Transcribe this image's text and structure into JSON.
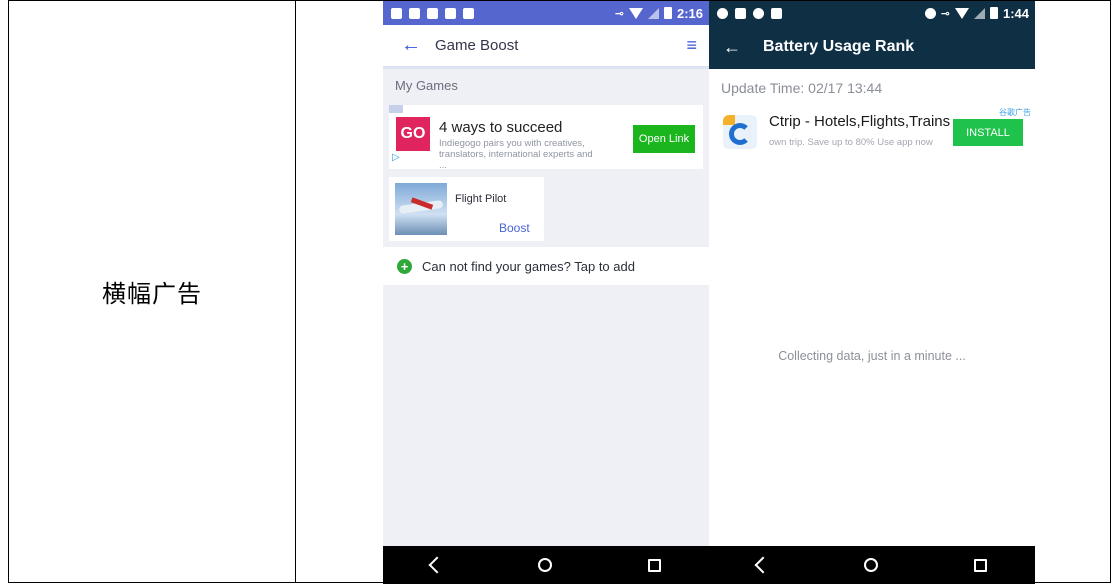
{
  "doc": {
    "label": "横幅广告"
  },
  "screen1": {
    "status": {
      "time": "2:16"
    },
    "toolbar": {
      "title": "Game Boost",
      "back_icon": "←",
      "sort_icon": "≡"
    },
    "section_title": "My Games",
    "ad": {
      "logo": "GO",
      "headline": "4 ways to succeed",
      "body": "Indiegogo pairs you with creatives, translators, international experts and ...",
      "button": "Open Link"
    },
    "game": {
      "name": "Flight Pilot",
      "action": "Boost"
    },
    "add_row": {
      "text": "Can not find your games? Tap to add",
      "icon": "+"
    }
  },
  "screen2": {
    "status": {
      "time": "1:44"
    },
    "toolbar": {
      "title": "Battery Usage Rank",
      "back_icon": "←"
    },
    "update_time": "Update Time: 02/17 13:44",
    "ad": {
      "tag": "谷歌广告",
      "app_name": "Ctrip - Hotels,Flights,Trains",
      "description": "own trip. Save up to 80% Use app now",
      "button": "INSTALL"
    },
    "collecting": "Collecting data, just in a minute ..."
  },
  "colors": {
    "screen1_status": "#5666cf",
    "screen2_bar": "#0f2f45",
    "accent_blue": "#3b55d9",
    "install_green": "#1fc24a",
    "open_green": "#1bb51e"
  }
}
